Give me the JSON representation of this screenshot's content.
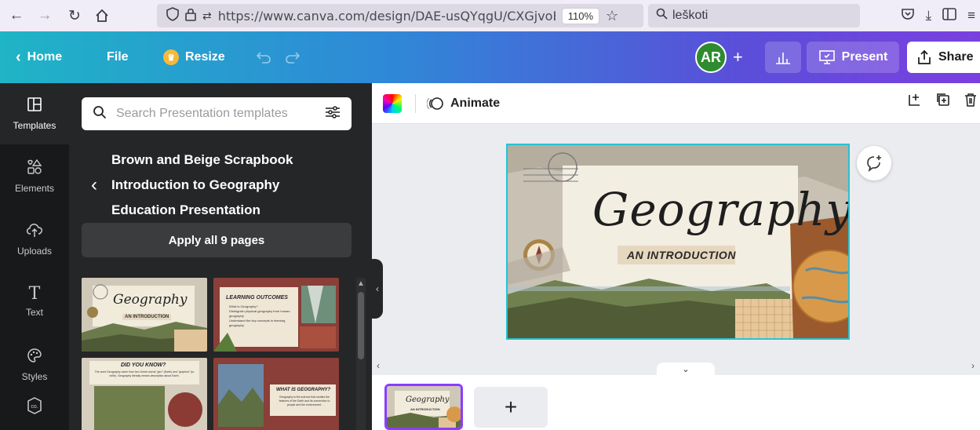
{
  "browser": {
    "url": "https://www.canva.com/design/DAE-usQYqgU/CXGjvoBaf",
    "zoom": "110%",
    "search_value": "leškoti"
  },
  "topbar": {
    "home": "Home",
    "file": "File",
    "resize": "Resize",
    "avatar_initials": "AR",
    "present": "Present",
    "share": "Share",
    "gradient_colors": [
      "#1fb4c6",
      "#2f88d7",
      "#5a4fd9",
      "#7b3fe0"
    ]
  },
  "rail": {
    "items": [
      {
        "label": "Templates",
        "icon": "templates-icon"
      },
      {
        "label": "Elements",
        "icon": "elements-icon"
      },
      {
        "label": "Uploads",
        "icon": "uploads-icon"
      },
      {
        "label": "Text",
        "icon": "text-icon"
      },
      {
        "label": "Styles",
        "icon": "styles-icon"
      },
      {
        "label": "",
        "icon": "brand-icon"
      }
    ]
  },
  "panel": {
    "search_placeholder": "Search Presentation templates",
    "template_title_lines": [
      "Brown and Beige Scrapbook",
      "Introduction to Geography",
      "Education Presentation"
    ],
    "apply_label": "Apply all 9 pages",
    "thumbs": [
      {
        "title": "Geography",
        "subtitle": "AN INTRODUCTION"
      },
      {
        "title": "LEARNING OUTCOMES",
        "bullets": [
          "What is Geography?",
          "Distinguish physical geography from human geography",
          "Understand the key concepts in learning geography"
        ]
      },
      {
        "title": "DID YOU KNOW?",
        "body": "The word Geography came from two Greek words \"geo\" (Earth) and \"graphos\" (to write). Geography literally means description about Earth."
      },
      {
        "title": "WHAT IS GEOGRAPHY?",
        "body": "Geography is the science that studies the features of the Earth and its connection to people and the environment."
      }
    ]
  },
  "editor": {
    "animate": "Animate"
  },
  "slide": {
    "title": "Geography",
    "subtitle": "AN INTRODUCTION",
    "selection_color": "#27c2d4"
  },
  "page_strip": {
    "thumb_title": "Geography",
    "thumb_subtitle": "AN INTRODUCTION",
    "add_label": "+"
  }
}
